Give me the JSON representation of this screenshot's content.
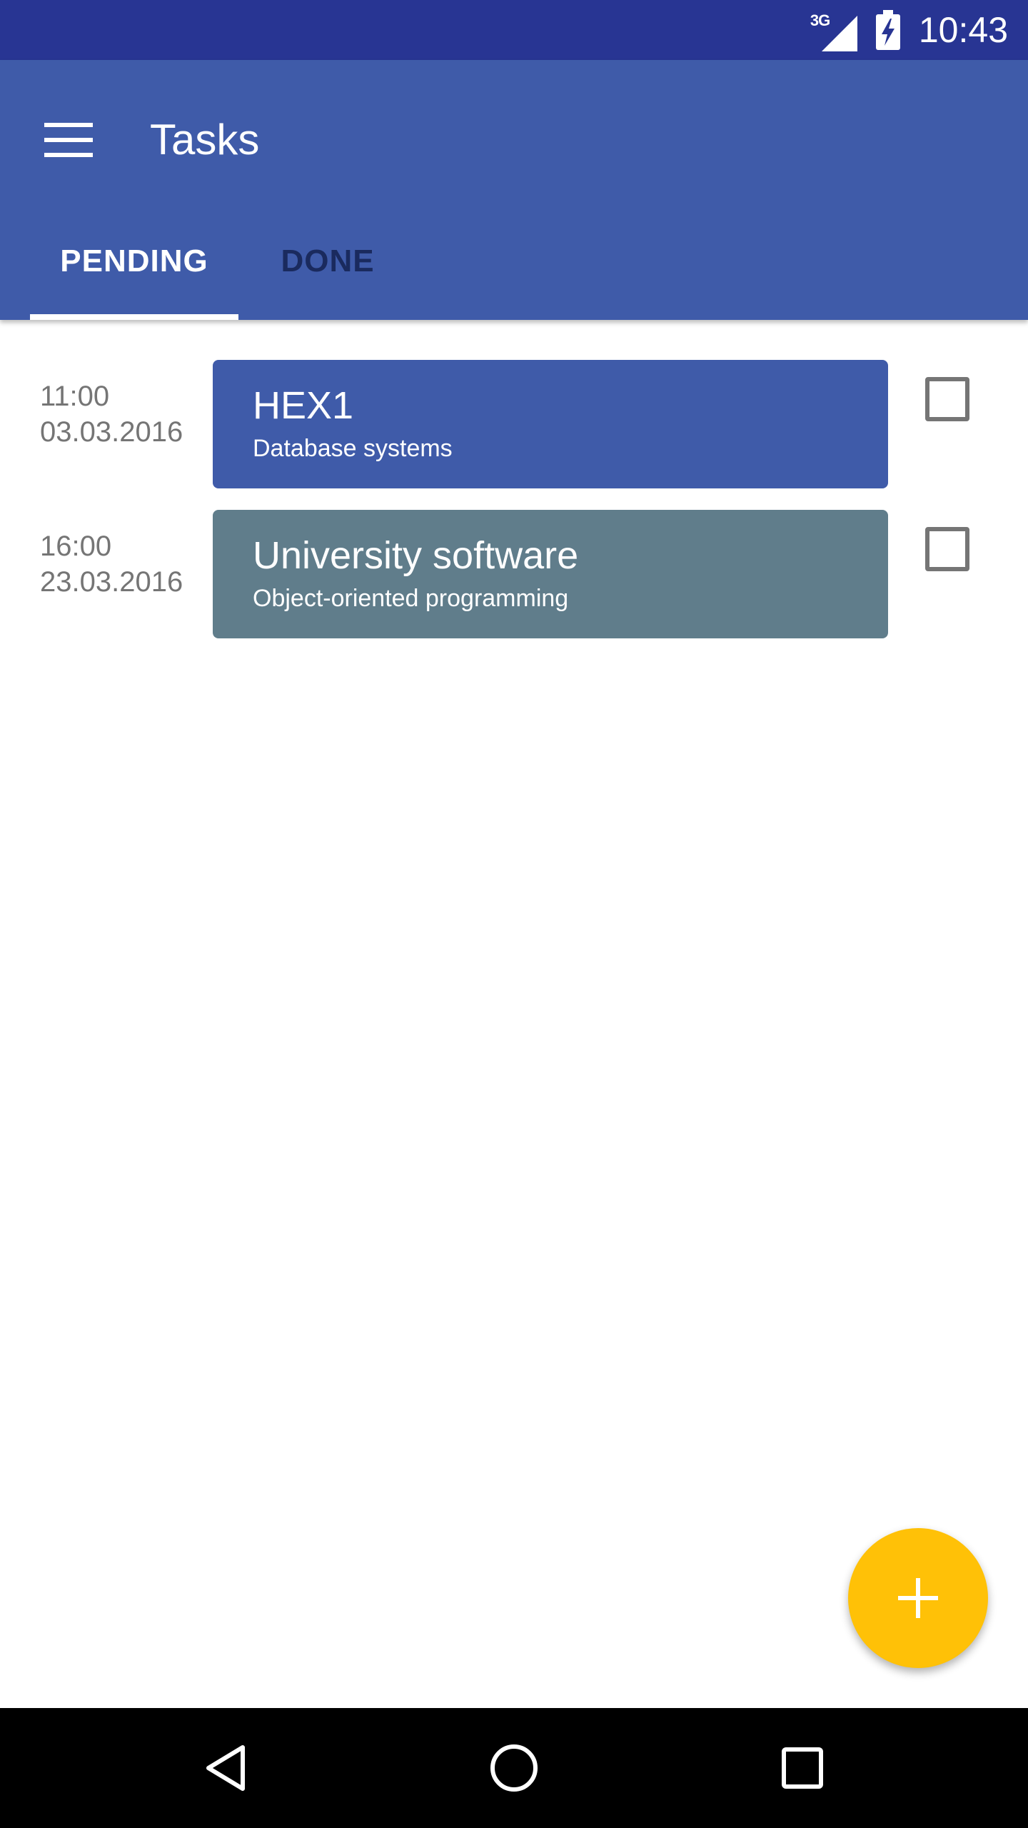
{
  "status_bar": {
    "network_type": "3G",
    "time": "10:43",
    "icons": [
      "signal-icon",
      "battery-charging-icon"
    ]
  },
  "app_bar": {
    "title": "Tasks",
    "menu_icon": "hamburger-menu-icon",
    "background": "#3f5ba9"
  },
  "tabs": [
    {
      "label": "PENDING",
      "selected": true
    },
    {
      "label": "DONE",
      "selected": false
    }
  ],
  "tasks": [
    {
      "time": "11:00",
      "date": "03.03.2016",
      "title": "HEX1",
      "subtitle": "Database systems",
      "color": "#3f5ba9",
      "checked": false
    },
    {
      "time": "16:00",
      "date": "23.03.2016",
      "title": "University software",
      "subtitle": "Object-oriented programming",
      "color": "#607d8b",
      "checked": false
    }
  ],
  "fab": {
    "icon": "plus-icon",
    "color": "#ffc107"
  },
  "nav_bar": {
    "icons": [
      "back-icon",
      "home-icon",
      "recents-icon"
    ]
  }
}
